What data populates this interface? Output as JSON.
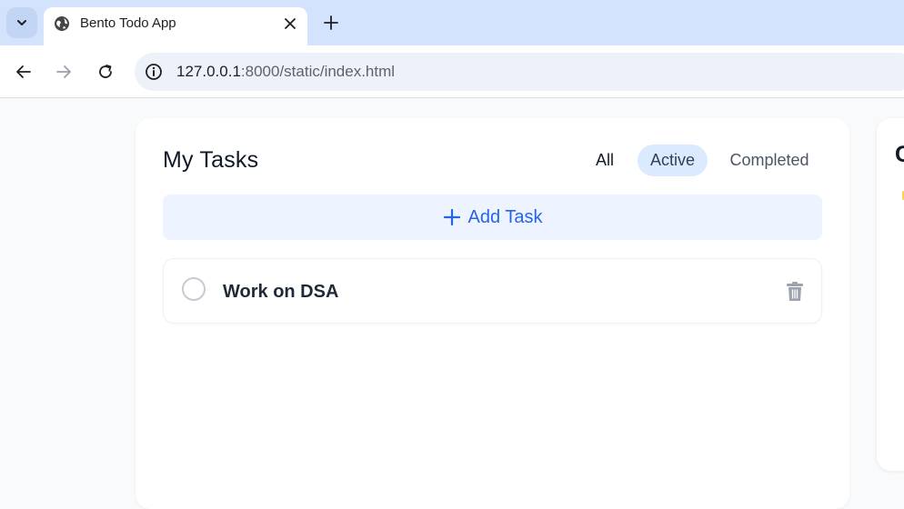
{
  "browser": {
    "tab_title": "Bento Todo App",
    "url_host": "127.0.0.1",
    "url_rest": ":8000/static/index.html"
  },
  "tasks_panel": {
    "title": "My Tasks",
    "filters": {
      "all": "All",
      "active": "Active",
      "completed": "Completed"
    },
    "active_filter": "Active",
    "add_task_label": "Add Task",
    "tasks": [
      {
        "text": "Work on DSA",
        "completed": false
      }
    ]
  },
  "side_panel": {
    "title_partial": "C"
  },
  "colors": {
    "accent_blue": "#2563eb",
    "active_filter_bg": "#dbeafe",
    "add_task_bg": "#eef4ff",
    "tabstrip_bg": "#d3e3fd"
  }
}
